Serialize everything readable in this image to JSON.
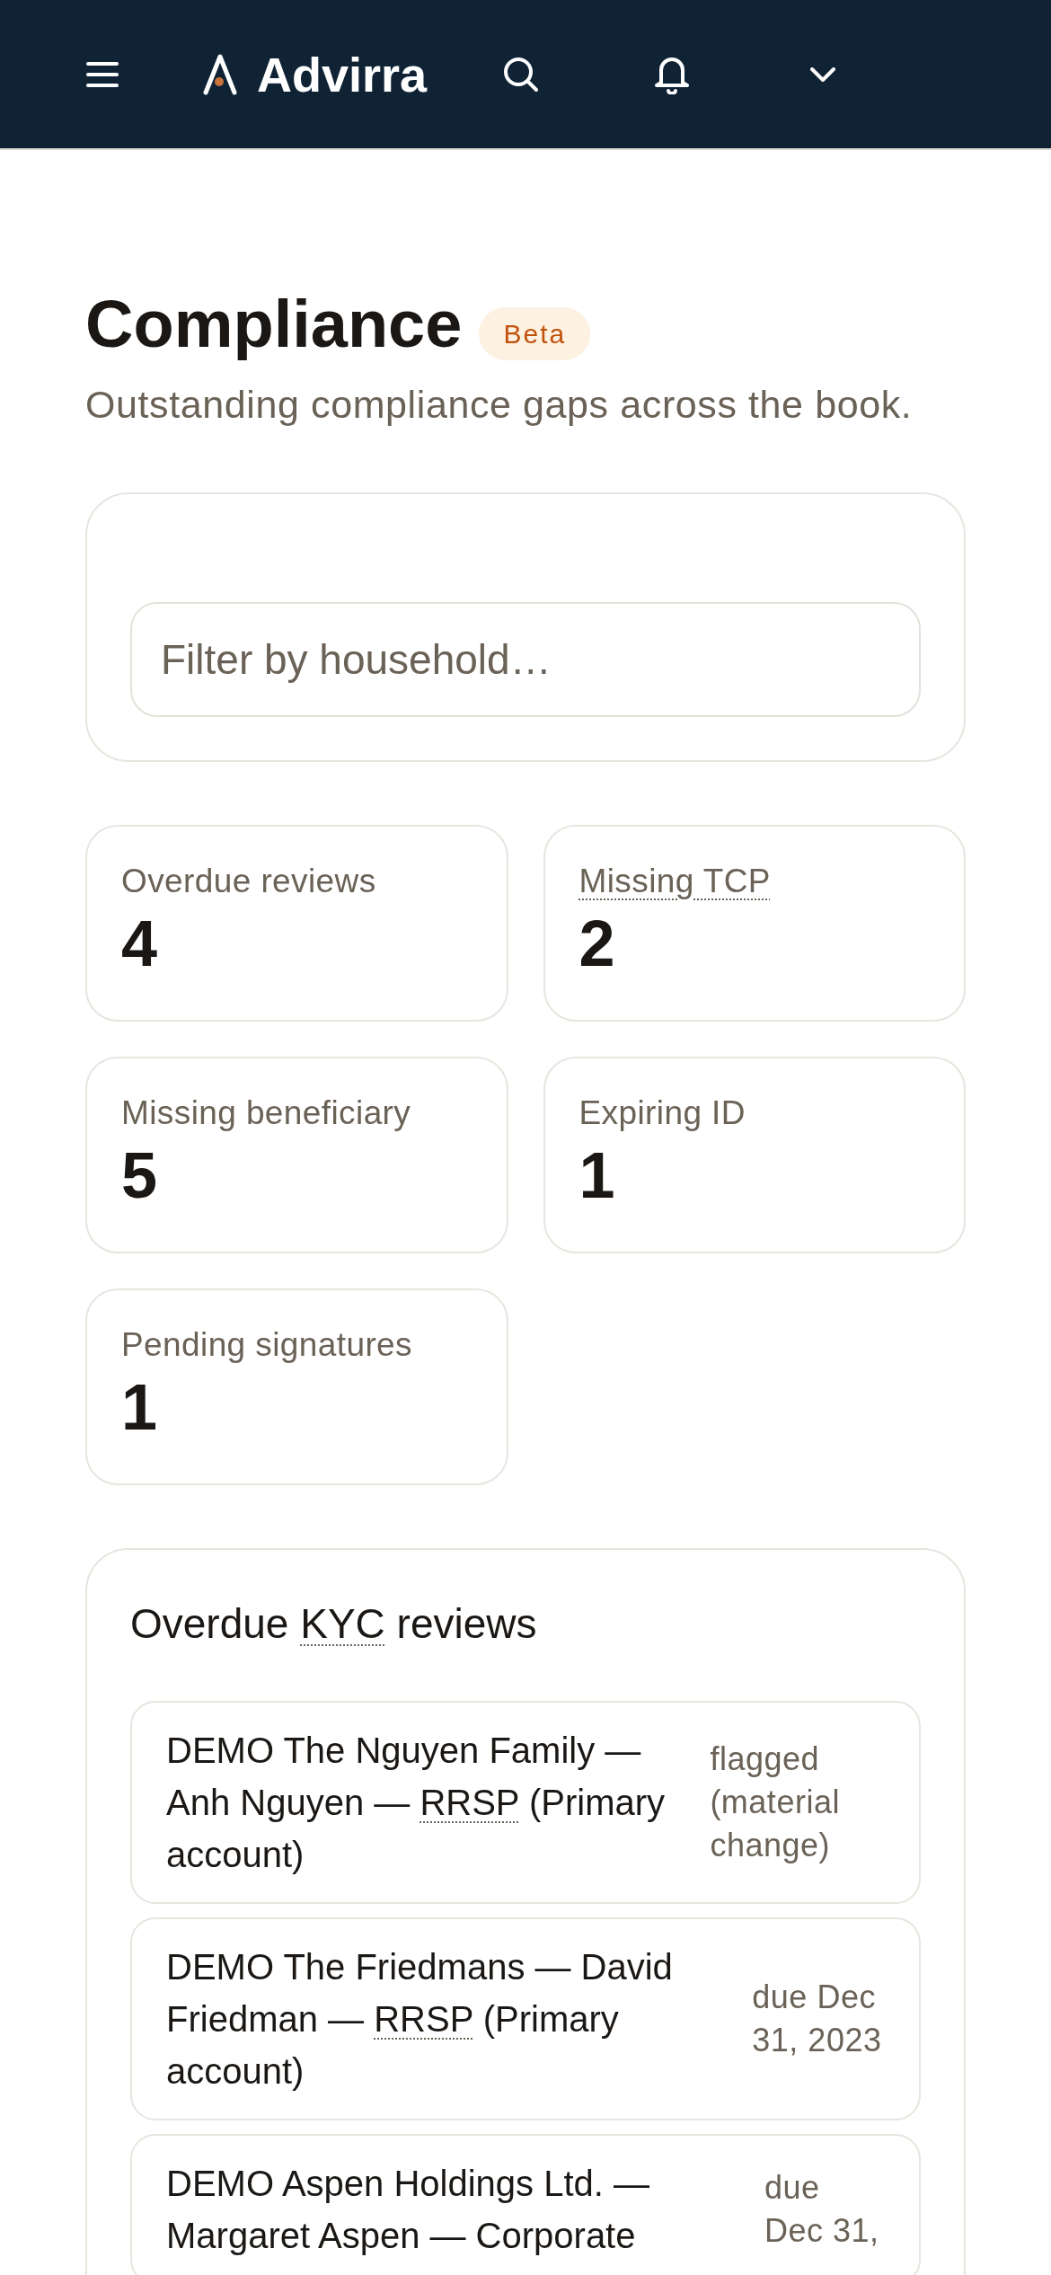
{
  "header": {
    "brand": "Advirra"
  },
  "page": {
    "title": "Compliance",
    "badge": "Beta",
    "subtitle": "Outstanding compliance gaps across the book."
  },
  "filter": {
    "placeholder": "Filter by household…"
  },
  "stats": [
    {
      "label": "Overdue reviews",
      "kind": "plain",
      "value": "4"
    },
    {
      "label": "Missing TCP",
      "kind": "abbreviation",
      "value": "2"
    },
    {
      "label": "Missing beneficiary",
      "kind": "plain",
      "value": "5"
    },
    {
      "label": "Expiring ID",
      "kind": "plain",
      "value": "1"
    },
    {
      "label": "Pending signatures",
      "kind": "plain",
      "value": "1"
    }
  ],
  "kyc_reviews": {
    "title": [
      {
        "text": "Overdue ",
        "kind": "plain"
      },
      {
        "text": "KYC",
        "kind": "abbreviation"
      },
      {
        "text": " reviews",
        "kind": "plain"
      }
    ],
    "rows": [
      {
        "description": [
          {
            "text": "DEMO The Nguyen Family — Anh Nguyen — ",
            "kind": "plain"
          },
          {
            "text": "RRSP",
            "kind": "abbreviation"
          },
          {
            "text": " (Primary account)",
            "kind": "plain"
          }
        ],
        "status": "flagged (material change)"
      },
      {
        "description": [
          {
            "text": "DEMO The Friedmans — David Friedman — ",
            "kind": "plain"
          },
          {
            "text": "RRSP",
            "kind": "abbreviation"
          },
          {
            "text": " (Primary account)",
            "kind": "plain"
          }
        ],
        "status": "due Dec 31, 2023"
      },
      {
        "description": [
          {
            "text": "DEMO Aspen Holdings Ltd. — Margaret Aspen — Corporate",
            "kind": "plain"
          }
        ],
        "status": "due Dec 31,"
      }
    ]
  }
}
